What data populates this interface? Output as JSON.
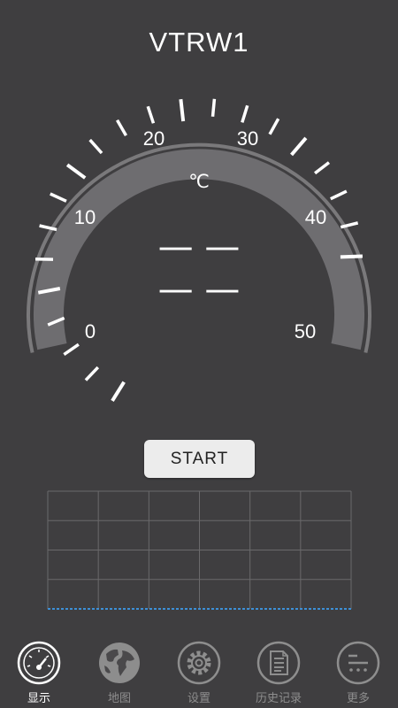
{
  "device_name": "VTRW1",
  "gauge": {
    "unit": "℃",
    "min": 0,
    "max": 50,
    "scale_labels": [
      "0",
      "10",
      "20",
      "30",
      "40",
      "50"
    ],
    "reading_primary": "— —",
    "reading_secondary": "— —"
  },
  "start_button": "START",
  "chart": {
    "grid_columns": 6,
    "grid_rows": 4,
    "baseline_color": "#3d8fd6"
  },
  "nav": {
    "items": [
      {
        "label": "显示",
        "icon": "gauge-icon",
        "active": true
      },
      {
        "label": "地图",
        "icon": "globe-icon",
        "active": false
      },
      {
        "label": "设置",
        "icon": "gear-icon",
        "active": false
      },
      {
        "label": "历史记录",
        "icon": "document-icon",
        "active": false
      },
      {
        "label": "更多",
        "icon": "more-icon",
        "active": false
      }
    ]
  }
}
